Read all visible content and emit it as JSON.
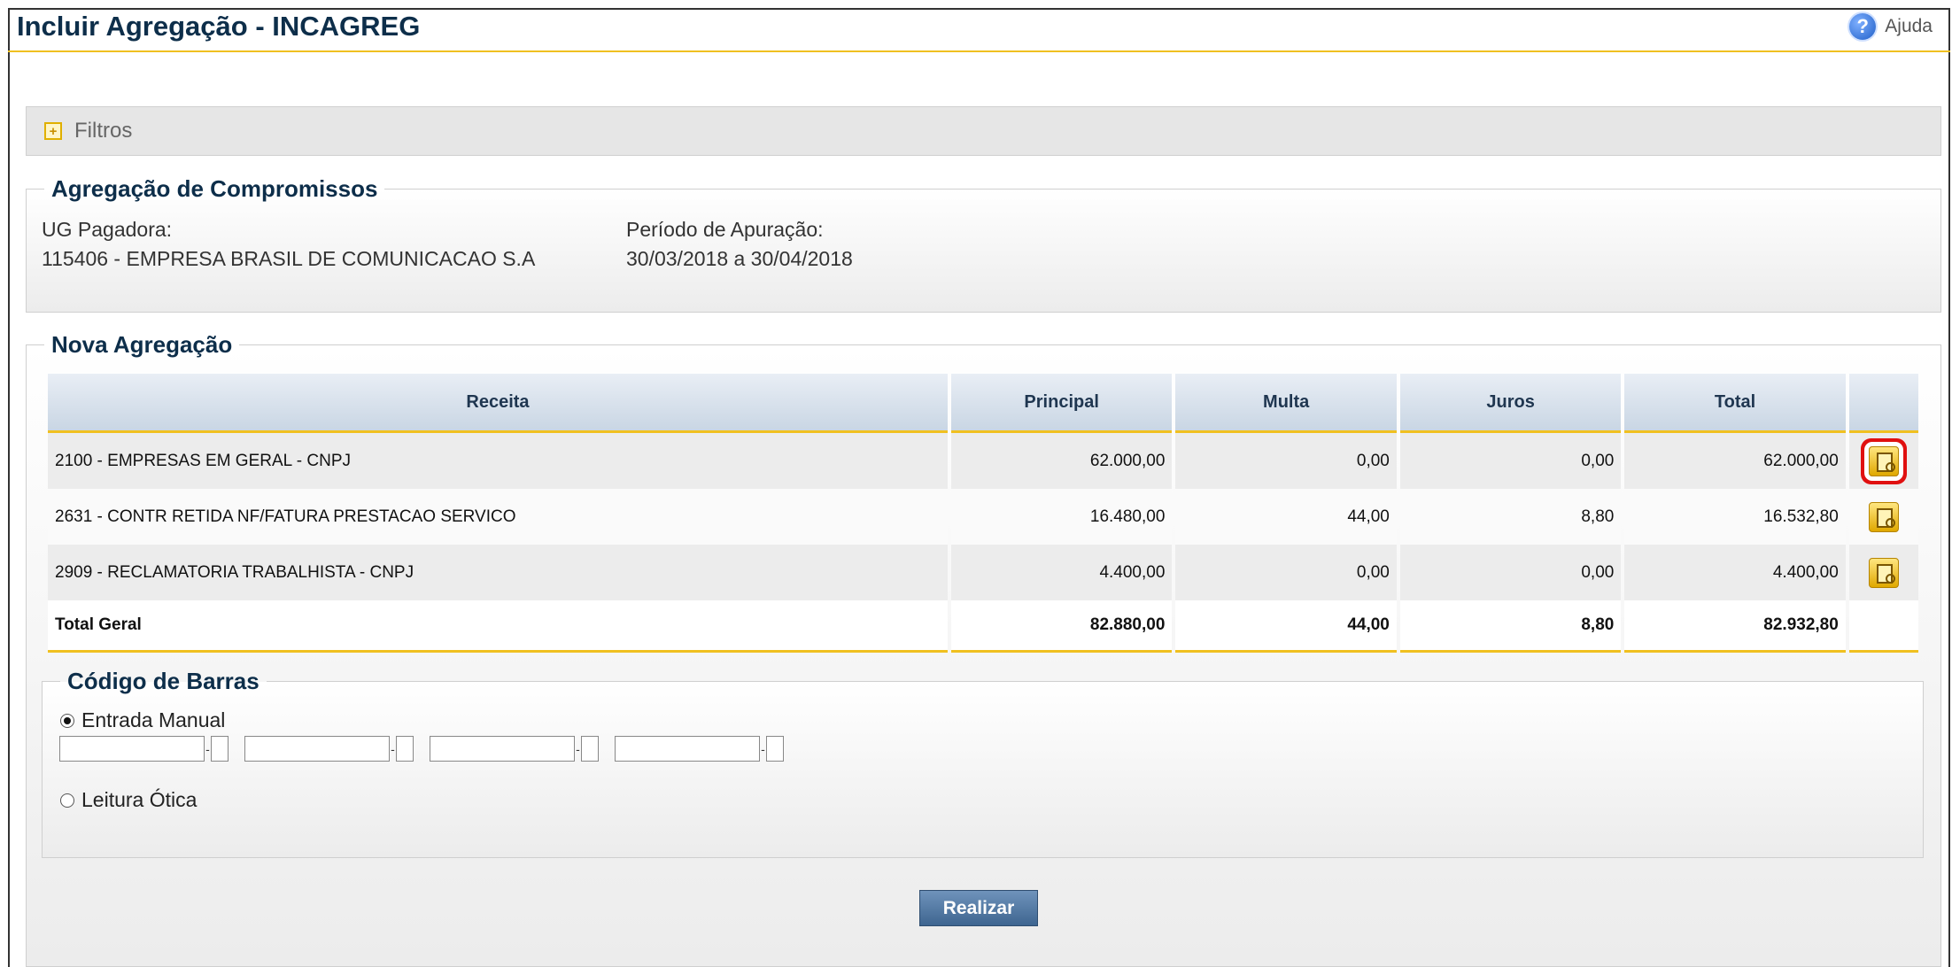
{
  "page": {
    "title": "Incluir Agregação - INCAGREG",
    "help_label": "Ajuda",
    "help_icon": "question-icon"
  },
  "filters": {
    "label": "Filtros",
    "icon": "expand-plus-icon"
  },
  "aggregation": {
    "legend": "Agregação de Compromissos",
    "ug_label": "UG Pagadora:",
    "ug_value": "115406 - EMPRESA BRASIL DE COMUNICACAO S.A",
    "period_label": "Período de Apuração:",
    "period_value": "30/03/2018 a 30/04/2018"
  },
  "nova": {
    "legend": "Nova Agregação",
    "columns": [
      "Receita",
      "Principal",
      "Multa",
      "Juros",
      "Total"
    ],
    "rows": [
      {
        "receita": "2100 - EMPRESAS EM GERAL - CNPJ",
        "principal": "62.000,00",
        "multa": "0,00",
        "juros": "0,00",
        "total": "62.000,00",
        "icon": "document-search-icon"
      },
      {
        "receita": "2631 - CONTR RETIDA NF/FATURA PRESTACAO SERVICO",
        "principal": "16.480,00",
        "multa": "44,00",
        "juros": "8,80",
        "total": "16.532,80",
        "icon": "document-search-icon"
      },
      {
        "receita": "2909 - RECLAMATORIA TRABALHISTA - CNPJ",
        "principal": "4.400,00",
        "multa": "0,00",
        "juros": "0,00",
        "total": "4.400,00",
        "icon": "document-search-icon"
      }
    ],
    "total": {
      "label": "Total Geral",
      "principal": "82.880,00",
      "multa": "44,00",
      "juros": "8,80",
      "total": "82.932,80"
    }
  },
  "barcode": {
    "legend": "Código de Barras",
    "manual_label": "Entrada Manual",
    "manual_selected": true,
    "optical_label": "Leitura Ótica",
    "optical_selected": false,
    "fields": [
      "",
      "",
      "",
      ""
    ],
    "check_digits": [
      "",
      "",
      "",
      ""
    ]
  },
  "actions": {
    "submit_label": "Realizar"
  },
  "colors": {
    "accent": "#f0c020",
    "title": "#0d2e4a",
    "button": "#4a6f99",
    "highlight": "#e01010"
  }
}
